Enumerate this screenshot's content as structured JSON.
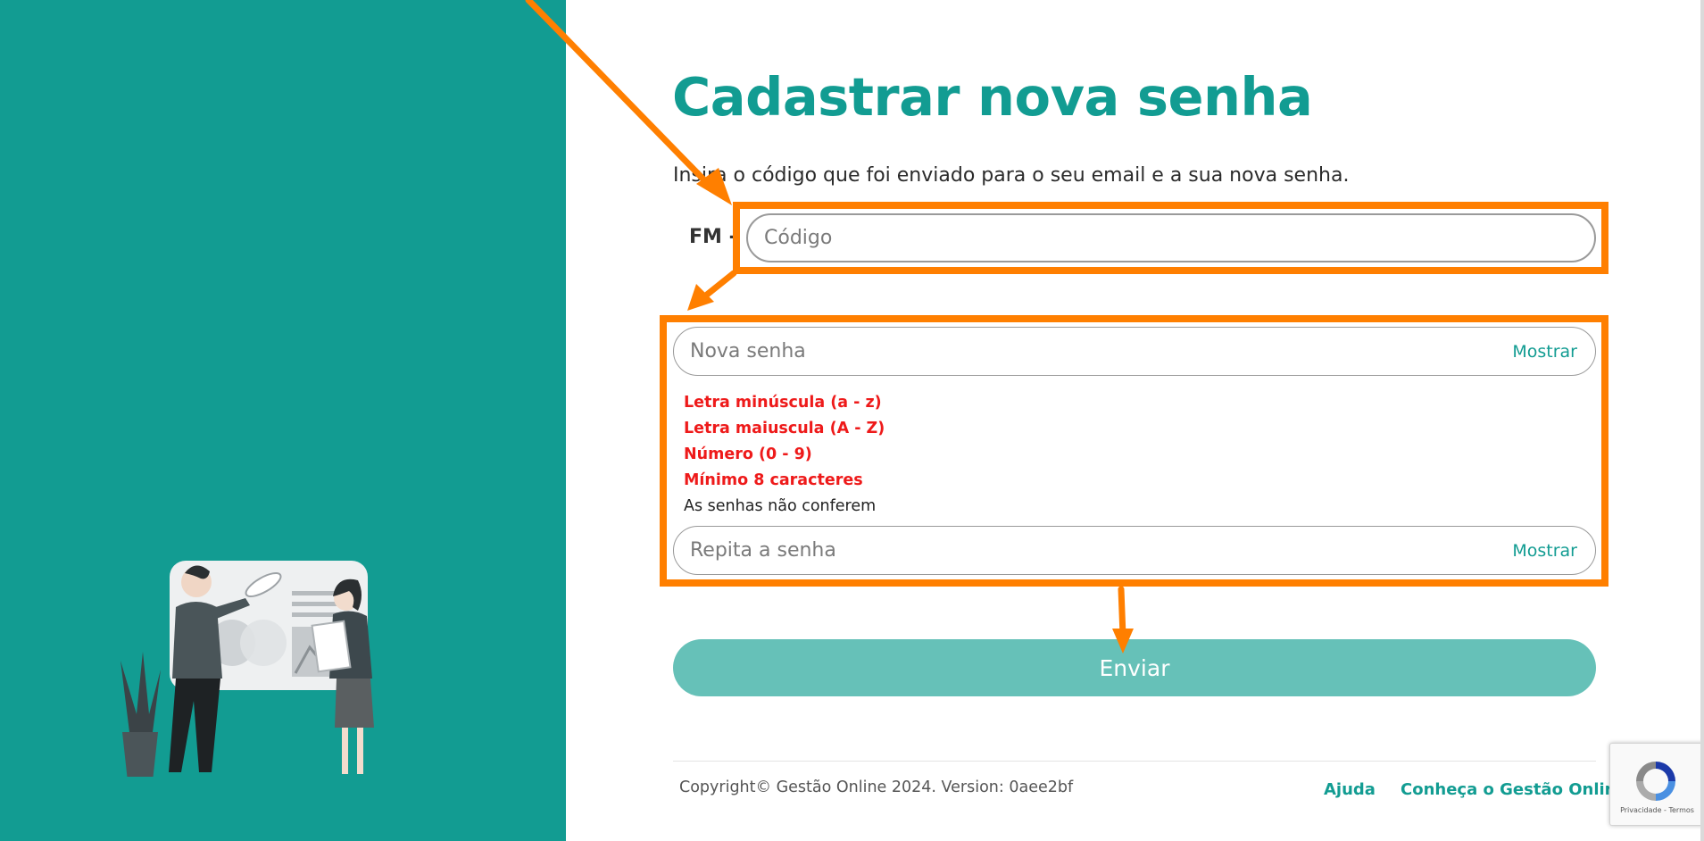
{
  "page": {
    "title": "Cadastrar nova senha",
    "subtitle": "Insira o código que foi enviado para o seu email e a sua nova senha."
  },
  "code_field": {
    "prefix": "FM -",
    "placeholder": "Código",
    "value": ""
  },
  "password_field": {
    "placeholder": "Nova senha",
    "show_label": "Mostrar"
  },
  "password_rules": {
    "lowercase": "Letra minúscula (a - z)",
    "uppercase": "Letra maiuscula (A - Z)",
    "number": "Número (0 - 9)",
    "min_length": "Mínimo 8 caracteres",
    "mismatch": "As senhas não conferem"
  },
  "repeat_field": {
    "placeholder": "Repita a senha",
    "show_label": "Mostrar"
  },
  "submit": {
    "label": "Enviar"
  },
  "footer": {
    "copyright": "Copyright© Gestão Online 2024. Version: 0aee2bf",
    "help_link": "Ajuda",
    "about_link": "Conheça o Gestão Online"
  },
  "recaptcha": {
    "links": "Privacidade - Termos"
  },
  "colors": {
    "brand": "#129c92",
    "button": "#66c1b8",
    "rule_error": "#ee1a1a",
    "annotation": "#ff7f00"
  }
}
